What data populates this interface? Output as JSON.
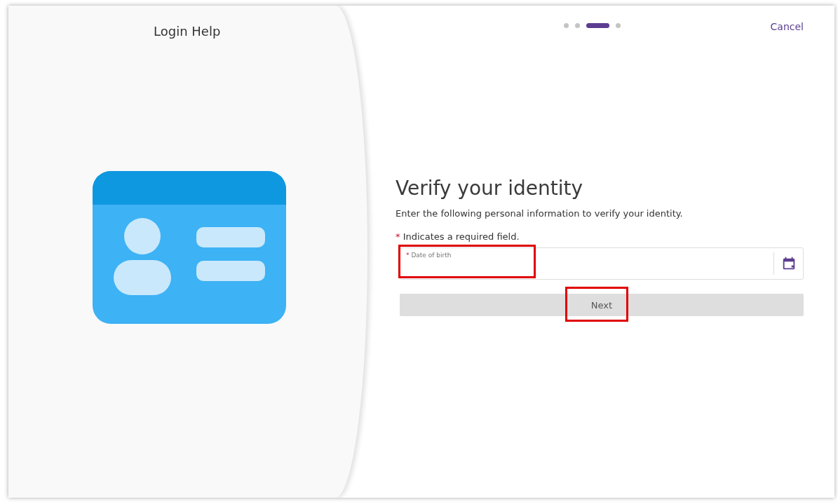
{
  "header": {
    "title": "Login Help",
    "cancel": "Cancel"
  },
  "steps": [
    {
      "selected": false
    },
    {
      "selected": false
    },
    {
      "selected": true
    },
    {
      "selected": false
    }
  ],
  "form": {
    "heading": "Verify your identity",
    "intro": "Enter the following personal information to verify your identity.",
    "required_mark": "*",
    "required_note": "Indicates a required field.",
    "field": {
      "required_mark": "*",
      "label": "Date of birth",
      "highlighted": true
    },
    "next_button": {
      "label": "Next",
      "disabled": true,
      "highlighted": true
    }
  }
}
